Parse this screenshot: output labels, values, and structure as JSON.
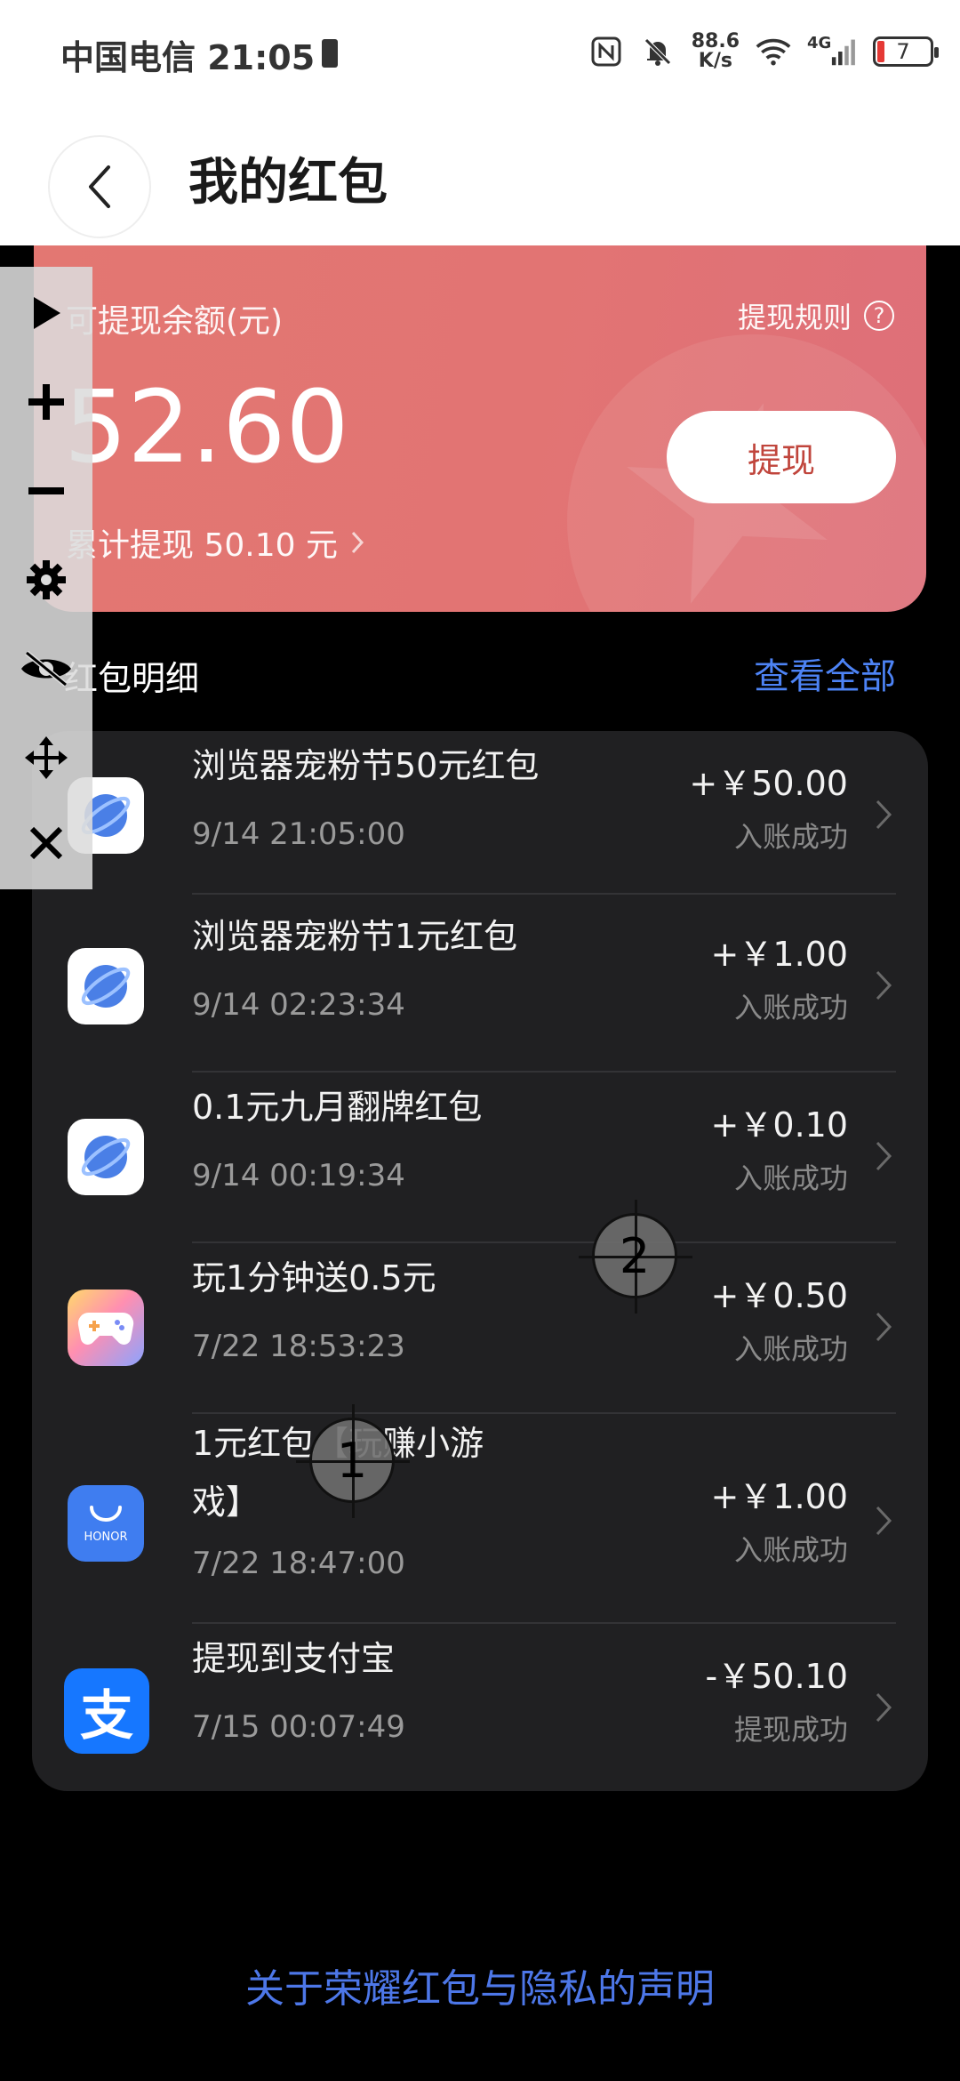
{
  "status_bar": {
    "carrier_time": "中国电信 21:05",
    "net_speed_top": "88.6",
    "net_speed_unit": "K/s",
    "signal_label": "4G",
    "battery": "7"
  },
  "header": {
    "title": "我的红包",
    "back_icon": "chevron-left-icon"
  },
  "balance_card": {
    "label": "可提现余额(元)",
    "rules_label": "提现规则",
    "amount": "52.60",
    "withdraw_button": "提现",
    "total_withdrawn": "累计提现 50.10 元"
  },
  "details": {
    "title": "红包明细",
    "view_all": "查看全部"
  },
  "items": [
    {
      "icon": "browser-icon",
      "title": "浏览器宠粉节50元红包",
      "time": "9/14 21:05:00",
      "amount": "+￥50.00",
      "status": "入账成功"
    },
    {
      "icon": "browser-icon",
      "title": "浏览器宠粉节1元红包",
      "time": "9/14 02:23:34",
      "amount": "+￥1.00",
      "status": "入账成功"
    },
    {
      "icon": "browser-icon",
      "title": "0.1元九月翻牌红包",
      "time": "9/14 00:19:34",
      "amount": "+￥0.10",
      "status": "入账成功"
    },
    {
      "icon": "game-controller-icon",
      "title": "玩1分钟送0.5元",
      "time": "7/22 18:53:23",
      "amount": "+￥0.50",
      "status": "入账成功"
    },
    {
      "icon": "honor-store-icon",
      "title": "1元红包【玩赚小游戏】",
      "time": "7/22 18:47:00",
      "amount": "+￥1.00",
      "status": "入账成功"
    },
    {
      "icon": "alipay-icon",
      "title": "提现到支付宝",
      "time": "7/15 00:07:49",
      "amount": "-￥50.10",
      "status": "提现成功"
    }
  ],
  "honor_logo_text": "HONOR",
  "alipay_glyph": "支",
  "footer_link": "关于荣耀红包与隐私的声明",
  "markers": [
    "1",
    "2"
  ],
  "colors": {
    "card_gradient_start": "#e37772",
    "card_gradient_end": "#de6f79",
    "link_blue": "#4d83f5",
    "list_bg": "#202022"
  }
}
